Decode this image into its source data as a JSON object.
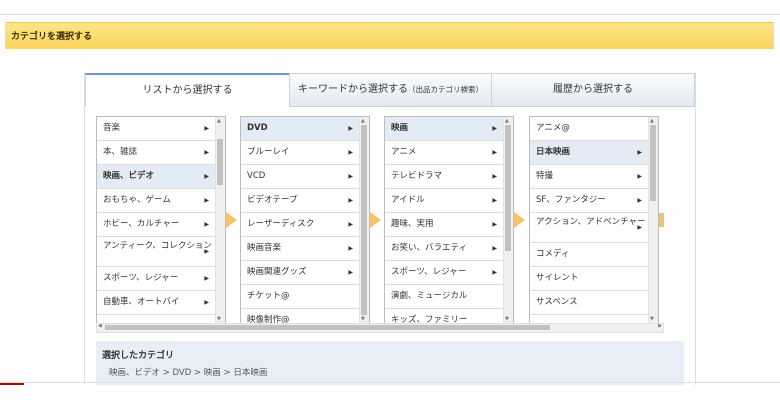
{
  "header": {
    "title": "カテゴリを選択する"
  },
  "tabs": [
    {
      "label": "リストから選択する"
    },
    {
      "label": "キーワードから選択する",
      "sub": "（出品カテゴリ検索）"
    },
    {
      "label": "履歴から選択する"
    }
  ],
  "columns": [
    {
      "items": [
        {
          "label": "音楽",
          "arrow": "▶"
        },
        {
          "label": "本、雑誌",
          "arrow": "▶"
        },
        {
          "label": "映画、ビデオ",
          "arrow": "▶",
          "selected": true
        },
        {
          "label": "おもちゃ、ゲーム",
          "arrow": "▶"
        },
        {
          "label": "ホビー、カルチャー",
          "arrow": "▶"
        },
        {
          "label": "アンティーク、コレクション",
          "arrow": "▶",
          "tall": true
        },
        {
          "label": "スポーツ、レジャー",
          "arrow": "▶"
        },
        {
          "label": "自動車、オートバイ",
          "arrow": "▶"
        }
      ]
    },
    {
      "items": [
        {
          "label": "DVD",
          "arrow": "▶",
          "selected": true
        },
        {
          "label": "ブルーレイ",
          "arrow": "▶"
        },
        {
          "label": "VCD",
          "arrow": "▶"
        },
        {
          "label": "ビデオテープ",
          "arrow": "▶"
        },
        {
          "label": "レーザーディスク",
          "arrow": "▶"
        },
        {
          "label": "映画音楽",
          "arrow": "▶"
        },
        {
          "label": "映画関連グッズ",
          "arrow": "▶"
        },
        {
          "label": "チケット@",
          "arrow": ""
        },
        {
          "label": "映像制作@",
          "arrow": ""
        }
      ]
    },
    {
      "items": [
        {
          "label": "映画",
          "arrow": "▶",
          "selected": true
        },
        {
          "label": "アニメ",
          "arrow": "▶"
        },
        {
          "label": "テレビドラマ",
          "arrow": "▶"
        },
        {
          "label": "アイドル",
          "arrow": "▶"
        },
        {
          "label": "趣味、実用",
          "arrow": "▶"
        },
        {
          "label": "お笑い、バラエティ",
          "arrow": "▶"
        },
        {
          "label": "スポーツ、レジャー",
          "arrow": "▶"
        },
        {
          "label": "演劇、ミュージカル",
          "arrow": ""
        },
        {
          "label": "キッズ、ファミリー",
          "arrow": ""
        }
      ]
    },
    {
      "items": [
        {
          "label": "アニメ@",
          "arrow": ""
        },
        {
          "label": "日本映画",
          "arrow": "▶",
          "selected": true
        },
        {
          "label": "特撮",
          "arrow": "▶"
        },
        {
          "label": "SF、ファンタジー",
          "arrow": "▶"
        },
        {
          "label": "アクション、アドベンチャー",
          "arrow": "▶",
          "tall": true
        },
        {
          "label": "コメディ",
          "arrow": ""
        },
        {
          "label": "サイレント",
          "arrow": ""
        },
        {
          "label": "サスペンス",
          "arrow": ""
        }
      ]
    }
  ],
  "scroll_glyphs": {
    "up": "▲",
    "down": "▼",
    "left": "◀",
    "right": "▶"
  },
  "selected": {
    "title": "選択したカテゴリ",
    "path": "映画、ビデオ > DVD > 映画 > 日本映画"
  }
}
